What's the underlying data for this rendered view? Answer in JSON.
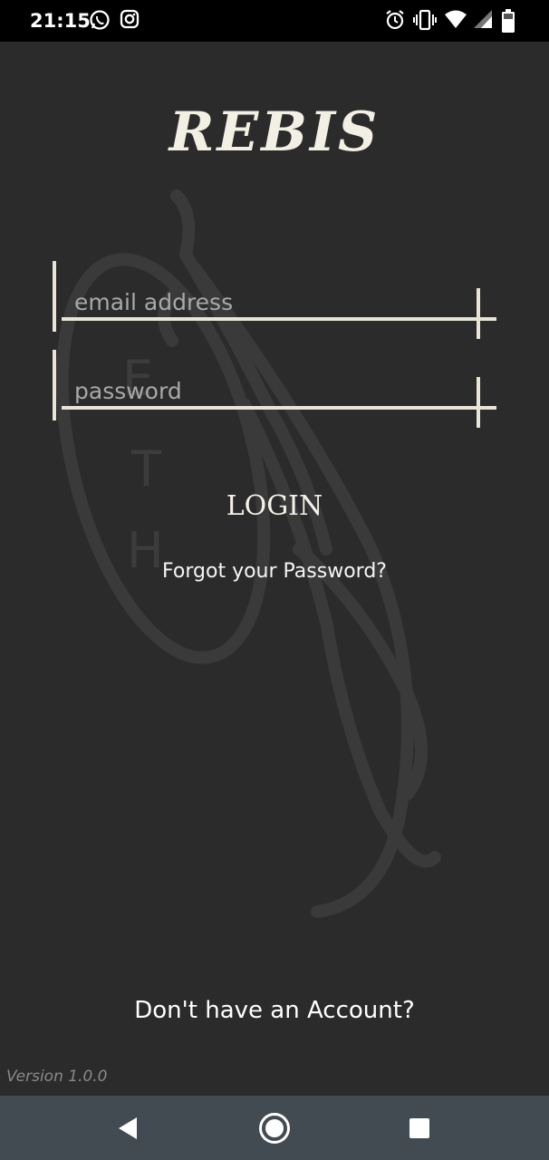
{
  "status_bar": {
    "time": "21:15",
    "left_icons": [
      "whatsapp-icon",
      "instagram-icon"
    ],
    "right_icons": [
      "alarm-icon",
      "vibrate-icon",
      "wifi-icon",
      "signal-icon",
      "battery-icon"
    ]
  },
  "app": {
    "title": "REBIS",
    "watermark_letters": [
      "E",
      "T",
      "H"
    ]
  },
  "form": {
    "email_placeholder": "email address",
    "email_value": "",
    "password_placeholder": "password",
    "password_value": "",
    "login_label": "LOGIN",
    "forgot_label": "Forgot your Password?"
  },
  "footer": {
    "signup_label": "Don't have an Account?",
    "version": "Version 1.0.0"
  },
  "nav_bar": {
    "icons": [
      "back-icon",
      "home-icon",
      "recents-icon"
    ]
  },
  "colors": {
    "background": "#2b2b2b",
    "accent": "#e8e4d6",
    "navbar": "#434b52"
  }
}
